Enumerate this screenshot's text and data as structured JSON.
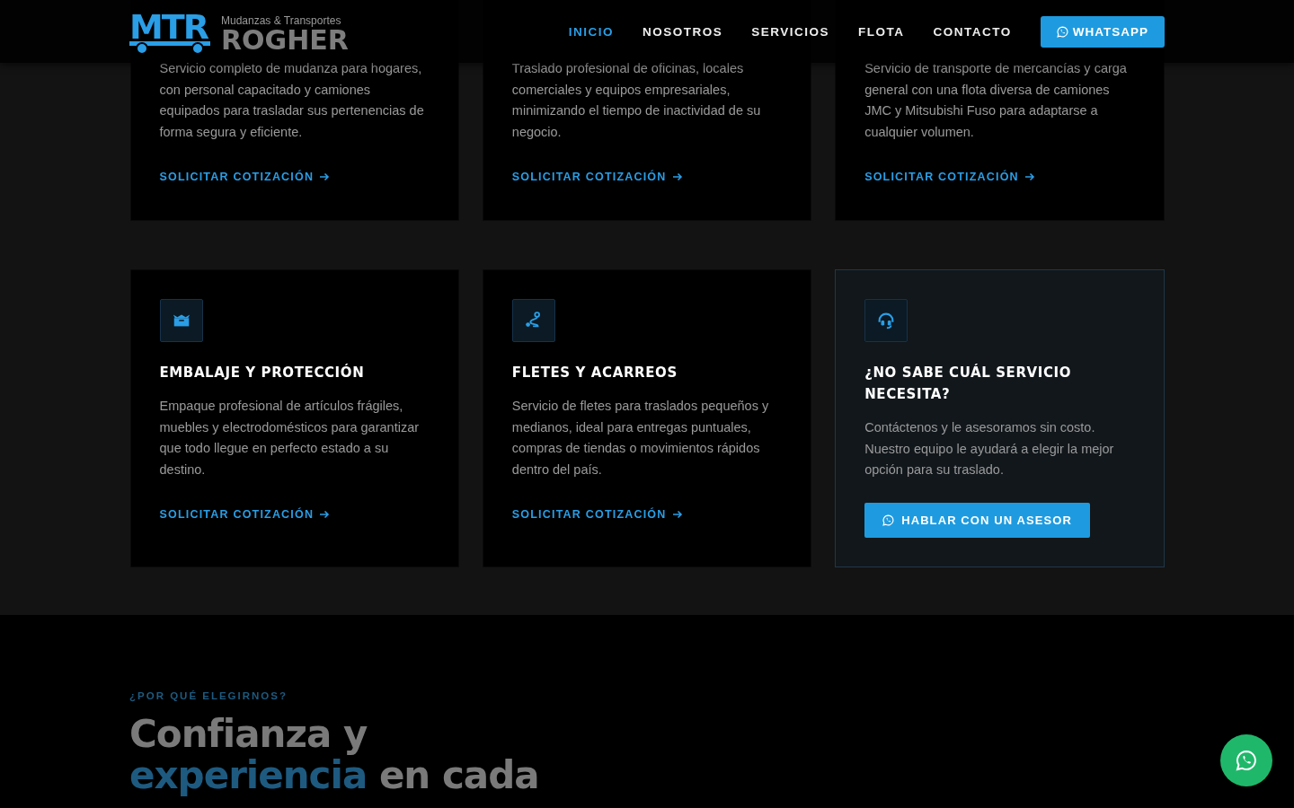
{
  "header": {
    "logo_mark": "MTR",
    "logo_tagline": "Mudanzas & Transportes",
    "logo_name": "ROGHER",
    "nav": [
      {
        "label": "INICIO",
        "selected": true
      },
      {
        "label": "NOSOTROS",
        "selected": false
      },
      {
        "label": "SERVICIOS",
        "selected": false
      },
      {
        "label": "FLOTA",
        "selected": false
      },
      {
        "label": "CONTACTO",
        "selected": false
      }
    ],
    "whatsapp_button": "WHATSAPP"
  },
  "services": [
    {
      "kind": "service",
      "description": "Servicio completo de mudanza para hogares, con personal capacitado y camiones equipados para trasladar sus pertenencias de forma segura y eficiente.",
      "link": "SOLICITAR COTIZACIÓN"
    },
    {
      "kind": "service",
      "description": "Traslado profesional de oficinas, locales comerciales y equipos empresariales, minimizando el tiempo de inactividad de su negocio.",
      "link": "SOLICITAR COTIZACIÓN"
    },
    {
      "kind": "service",
      "description": "Servicio de transporte de mercancías y carga general con una flota diversa de camiones JMC y Mitsubishi Fuso para adaptarse a cualquier volumen.",
      "link": "SOLICITAR COTIZACIÓN"
    },
    {
      "kind": "service",
      "title": "EMBALAJE Y PROTECCIÓN",
      "description": "Empaque profesional de artículos frágiles, muebles y electrodomésticos para garantizar que todo llegue en perfecto estado a su destino.",
      "link": "SOLICITAR COTIZACIÓN"
    },
    {
      "kind": "service",
      "title": "FLETES Y ACARREOS",
      "description": "Servicio de fletes para traslados pequeños y medianos, ideal para entregas puntuales, compras de tiendas o movimientos rápidos dentro del país.",
      "link": "SOLICITAR COTIZACIÓN"
    },
    {
      "kind": "cta",
      "title": "¿NO SABE CUÁL SERVICIO NECESITA?",
      "description": "Contáctenos y le asesoramos sin costo. Nuestro equipo le ayudará a elegir la mejor opción para su traslado.",
      "button": "HABLAR CON UN ASESOR"
    }
  ],
  "why": {
    "eyebrow": "¿POR QUÉ ELEGIRNOS?",
    "heading_parts": [
      {
        "text": "Confianza y ",
        "highlight": false
      },
      {
        "text": "experiencia",
        "highlight": true
      },
      {
        "text": " en cada",
        "highlight": false
      }
    ]
  }
}
